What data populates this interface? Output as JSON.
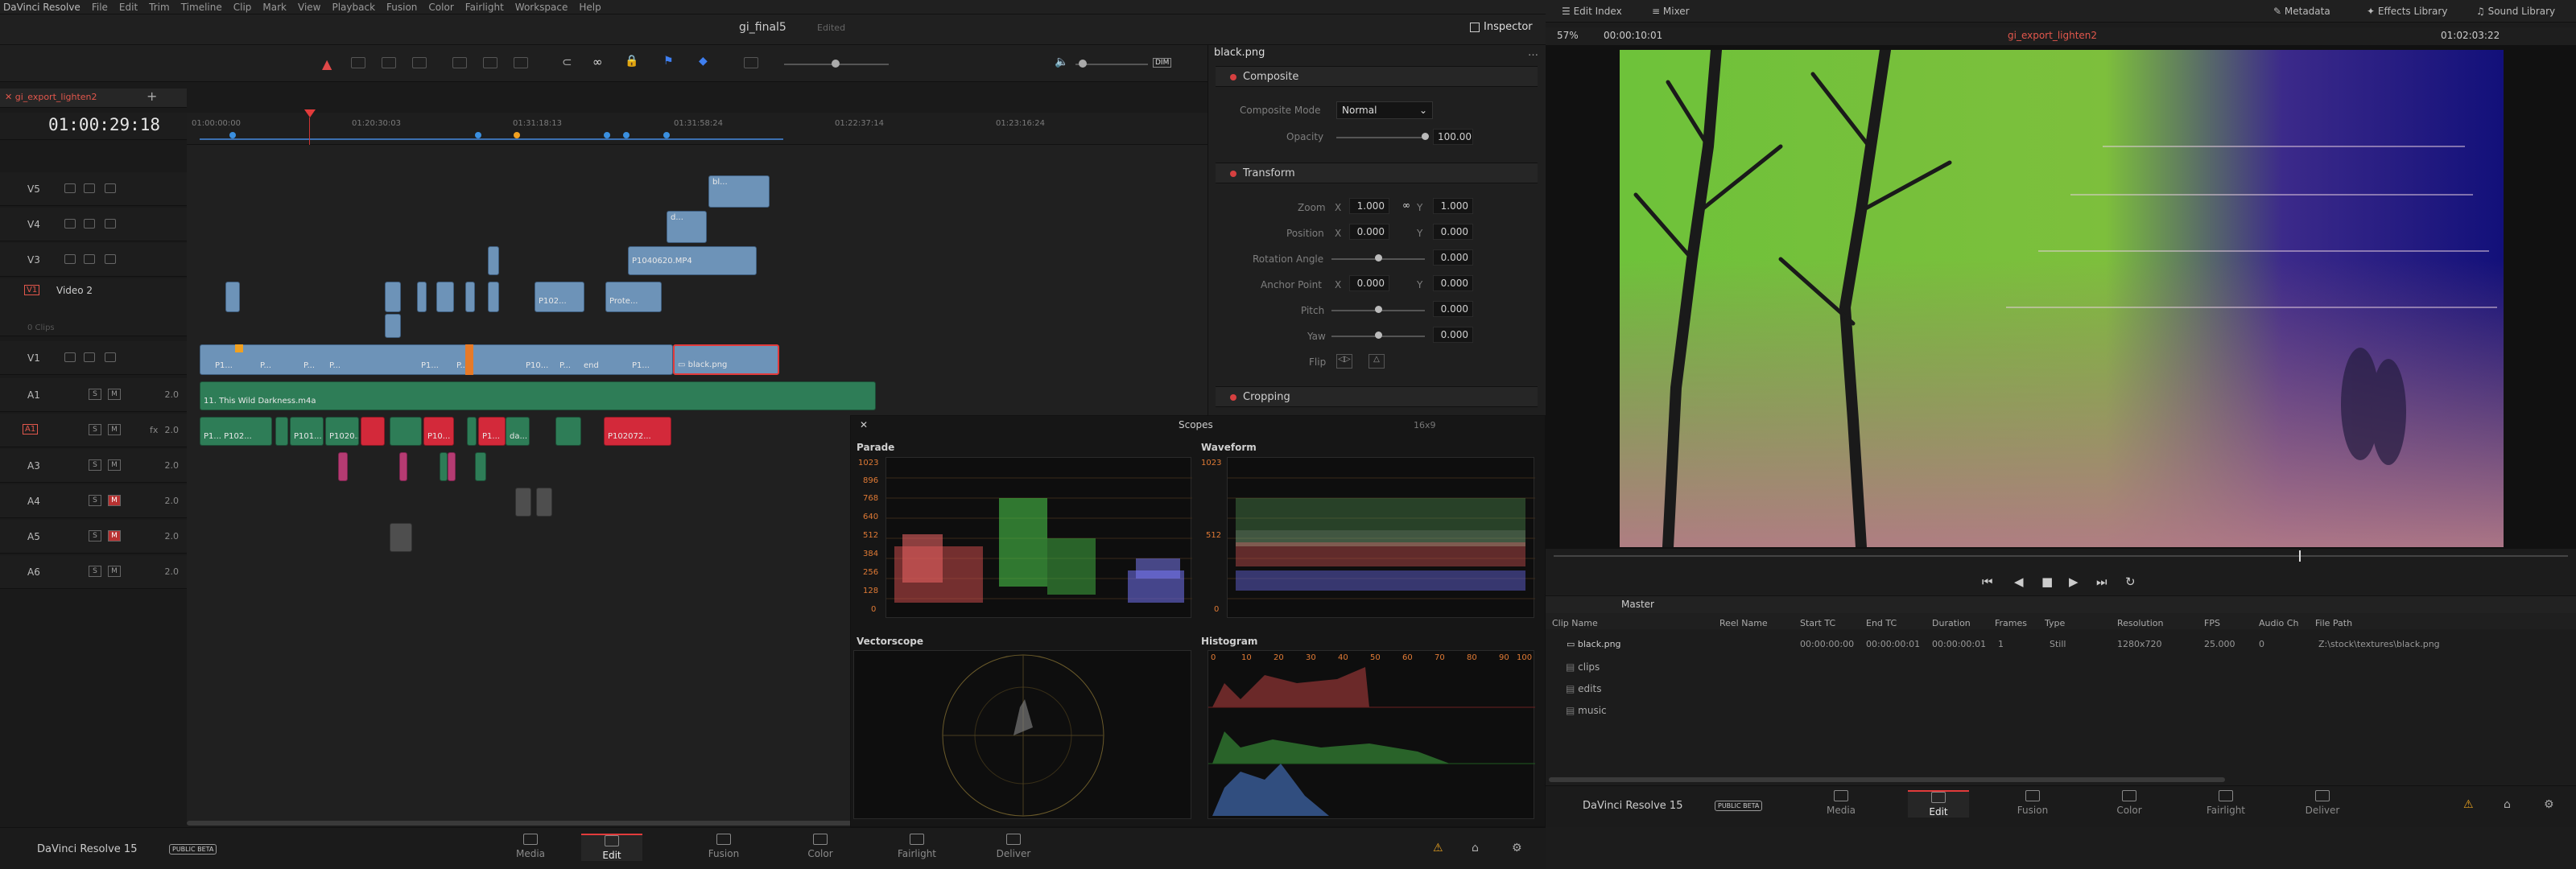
{
  "menu": {
    "app": "DaVinci Resolve",
    "items": [
      "File",
      "Edit",
      "Trim",
      "Timeline",
      "Clip",
      "Mark",
      "View",
      "Playback",
      "Fusion",
      "Color",
      "Fairlight",
      "Workspace",
      "Help"
    ]
  },
  "project": {
    "name": "gi_final5",
    "status": "Edited"
  },
  "inspector_button": "Inspector",
  "timeline": {
    "tab_name": "gi_export_lighten2",
    "timecode": "01:00:29:18",
    "ruler": [
      "01:00:00:00",
      "01:20:30:03",
      "01:31:18:13",
      "01:31:58:24",
      "01:22:37:14",
      "01:23:16:24"
    ],
    "tracks": [
      {
        "id": "V5",
        "name": ""
      },
      {
        "id": "V4",
        "name": ""
      },
      {
        "id": "V3",
        "name": ""
      },
      {
        "id": "V1",
        "name": "Video 2",
        "clips_label": "0 Clips"
      },
      {
        "id": "V1",
        "name": ""
      },
      {
        "id": "A1",
        "vol": "2.0"
      },
      {
        "id": "A1",
        "vol": "2.0",
        "fx": "fx"
      },
      {
        "id": "A3",
        "vol": "2.0"
      },
      {
        "id": "A4",
        "vol": "2.0"
      },
      {
        "id": "A5",
        "vol": "2.0"
      },
      {
        "id": "A6",
        "vol": "2.0"
      }
    ],
    "clip_labels": {
      "v5": "bl...",
      "v4": "d...",
      "v3_main": "P1040620.MP4",
      "v2a": "P102...",
      "v2b": "Prote...",
      "black": "black.png",
      "audio_main": "11. This Wild Darkness.m4a",
      "v1_labels": [
        "P1...",
        "P...",
        "P...",
        "P...",
        "P1...",
        "P...",
        "P10...",
        "P...",
        "end",
        "P1..."
      ],
      "a2_labels": [
        "P1...",
        "P102...",
        "P101...",
        "P1020...",
        "P10...",
        "P1...",
        "da...",
        "P102072..."
      ]
    }
  },
  "inspector": {
    "file": "black.png",
    "composite": {
      "title": "Composite",
      "mode_label": "Composite Mode",
      "mode_value": "Normal",
      "opacity_label": "Opacity",
      "opacity_value": "100.00"
    },
    "transform": {
      "title": "Transform",
      "zoom_label": "Zoom",
      "zoom_x": "1.000",
      "zoom_y": "1.000",
      "position_label": "Position",
      "pos_x": "0.000",
      "pos_y": "0.000",
      "rotation_label": "Rotation Angle",
      "rotation": "0.000",
      "anchor_label": "Anchor Point",
      "anchor_x": "0.000",
      "anchor_y": "0.000",
      "pitch_label": "Pitch",
      "pitch": "0.000",
      "yaw_label": "Yaw",
      "yaw": "0.000",
      "flip_label": "Flip"
    },
    "cropping": {
      "title": "Cropping"
    },
    "x": "X",
    "y": "Y"
  },
  "scopes": {
    "title": "Scopes",
    "aspect": "16x9",
    "parade": "Parade",
    "waveform": "Waveform",
    "vectorscope": "Vectorscope",
    "histogram": "Histogram",
    "levels": [
      "1023",
      "896",
      "768",
      "640",
      "512",
      "384",
      "256",
      "128",
      "0"
    ],
    "hist_ticks": [
      "0",
      "10",
      "20",
      "30",
      "40",
      "50",
      "60",
      "70",
      "80",
      "90",
      "100"
    ]
  },
  "bottom_nav": {
    "brand": "DaVinci Resolve 15",
    "beta": "PUBLIC BETA",
    "pages": [
      "Media",
      "Edit",
      "Fusion",
      "Color",
      "Fairlight",
      "Deliver"
    ],
    "active": "Edit"
  },
  "viewer": {
    "edit_index": "Edit Index",
    "mixer": "Mixer",
    "metadata": "Metadata",
    "effects": "Effects Library",
    "sound": "Sound Library",
    "zoom": "57%",
    "tc_left": "00:00:10:01",
    "timeline_name": "gi_export_lighten2",
    "tc_right": "01:02:03:22"
  },
  "media_pool": {
    "bin": "Master",
    "columns": [
      "Clip Name",
      "Reel Name",
      "Start TC",
      "End TC",
      "Duration",
      "Frames",
      "Type",
      "Resolution",
      "FPS",
      "Audio Ch",
      "File Path"
    ],
    "rows": [
      {
        "name": "black.png",
        "reel": "",
        "start": "00:00:00:00",
        "end": "00:00:00:01",
        "duration": "00:00:00:01",
        "frames": "1",
        "type": "Still",
        "resolution": "1280x720",
        "fps": "25.000",
        "audio": "0",
        "path": "Z:\\stock\\textures\\black.png"
      }
    ],
    "folders": [
      "clips",
      "edits",
      "music"
    ]
  },
  "colors": {
    "accent": "#e64b3c",
    "video": "#6d93b8",
    "audio": "#2e7d57",
    "red": "#d3293a"
  }
}
